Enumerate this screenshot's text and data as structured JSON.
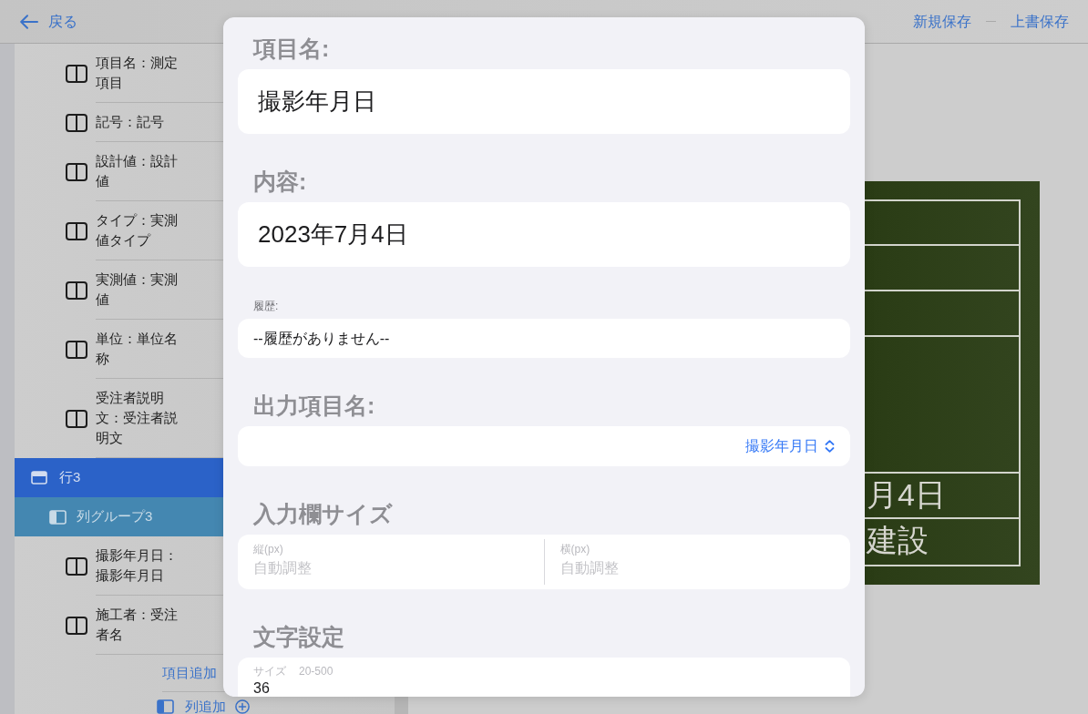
{
  "nav_bar": {
    "back": "戻る",
    "actions": [
      "新規保存",
      "上書保存"
    ]
  },
  "sidebar": {
    "items": [
      {
        "kind": "field",
        "label": "項目名：測定項目"
      },
      {
        "kind": "field",
        "label": "記号：記号"
      },
      {
        "kind": "field",
        "label": "設計値：設計値"
      },
      {
        "kind": "field",
        "label": "タイプ：実測値タイプ"
      },
      {
        "kind": "field",
        "label": "実測値：実測値"
      },
      {
        "kind": "field",
        "label": "単位：単位名称"
      },
      {
        "kind": "field",
        "label": "受注者説明文：受注者説明文"
      },
      {
        "kind": "row",
        "label": "行3",
        "children": [
          {
            "kind": "group",
            "label": "列グループ3",
            "children": [
              {
                "kind": "field",
                "label": "撮影年月日：撮影年月日"
              },
              {
                "kind": "field",
                "label": "施工者：受注者名"
              },
              {
                "kind": "add_item",
                "label": "項目追加"
              }
            ]
          },
          {
            "kind": "add_group",
            "label": "列追加"
          }
        ]
      }
    ]
  },
  "signboard": {
    "texts": [
      "月4日",
      "建設"
    ]
  },
  "editor": {
    "sections": [
      {
        "kind": "text",
        "heading": "項目名:",
        "value": "撮影年月日"
      },
      {
        "kind": "text",
        "heading": "内容:",
        "value": "2023年7月4日"
      },
      {
        "kind": "history",
        "label": "履歴:",
        "value": "--履歴がありません--"
      },
      {
        "kind": "picker",
        "heading": "出力項目名:",
        "value": "撮影年月日"
      },
      {
        "kind": "size",
        "heading": "入力欄サイズ",
        "fields": [
          {
            "label": "縦(px)",
            "placeholder": "自動調整"
          },
          {
            "label": "横(px)",
            "placeholder": "自動調整"
          }
        ]
      },
      {
        "kind": "font",
        "heading": "文字設定",
        "label": "サイズ",
        "hint": "20-500",
        "value": "36"
      }
    ]
  }
}
